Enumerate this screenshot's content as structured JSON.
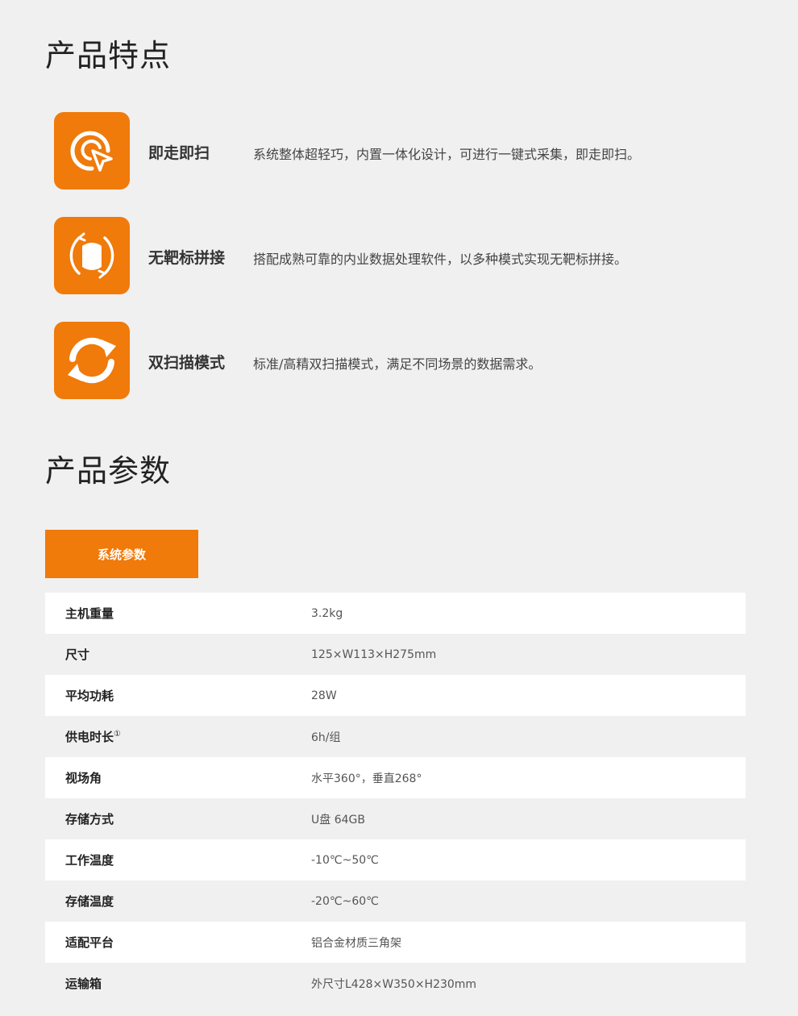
{
  "features_title": "产品特点",
  "features": [
    {
      "name": "即走即扫",
      "desc": "系统整体超轻巧，内置一体化设计，可进行一键式采集，即走即扫。",
      "icon": "cursor-target-icon"
    },
    {
      "name": "无靶标拼接",
      "desc": "搭配成熟可靠的内业数据处理软件，以多种模式实现无靶标拼接。",
      "icon": "cylinder-rotate-icon"
    },
    {
      "name": "双扫描模式",
      "desc": "标准/高精双扫描模式，满足不同场景的数据需求。",
      "icon": "cycle-arrows-icon"
    }
  ],
  "params_title": "产品参数",
  "tab_label": "系统参数",
  "params": [
    {
      "key": "主机重量",
      "value": "3.2kg"
    },
    {
      "key": "尺寸",
      "value": "125×W113×H275mm"
    },
    {
      "key": "平均功耗",
      "value": "28W"
    },
    {
      "key": "供电时长",
      "sup": "①",
      "value": "6h/组"
    },
    {
      "key": "视场角",
      "value": "水平360°，垂直268°"
    },
    {
      "key": "存储方式",
      "value": "U盘 64GB"
    },
    {
      "key": "工作温度",
      "value": "-10℃~50℃"
    },
    {
      "key": "存储温度",
      "value": "-20℃~60℃"
    },
    {
      "key": "适配平台",
      "value": "铝合金材质三角架"
    },
    {
      "key": "运输箱",
      "value": "外尺寸L428×W350×H230mm"
    }
  ],
  "colors": {
    "accent": "#f07a0a",
    "background": "#f0f0f0"
  }
}
